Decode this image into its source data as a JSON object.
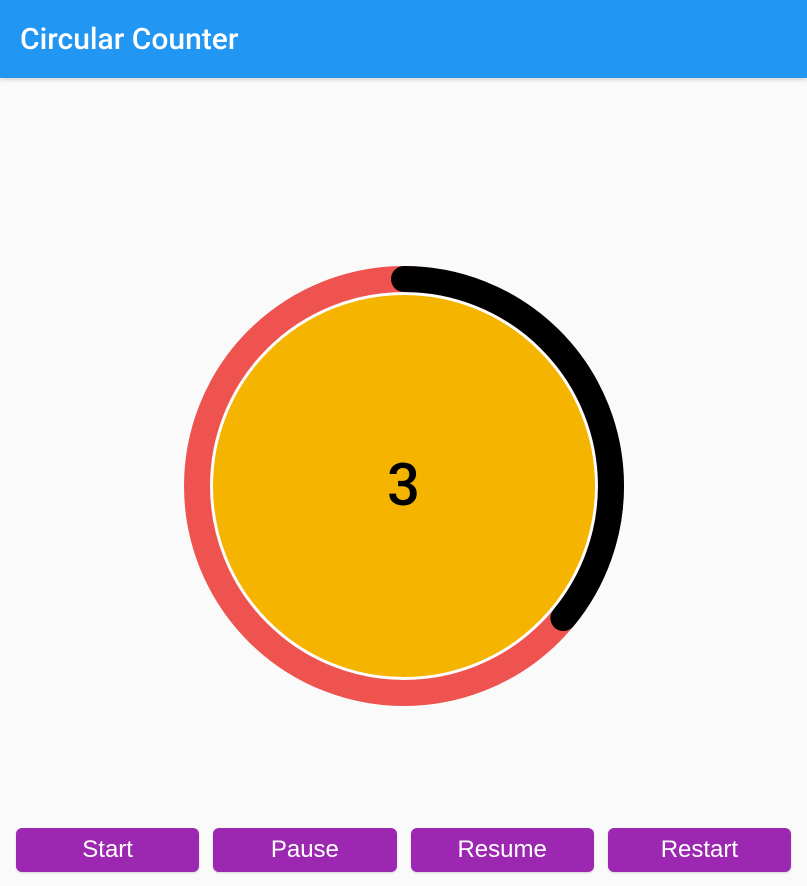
{
  "header": {
    "title": "Circular Counter"
  },
  "counter": {
    "value": "3",
    "progress_fraction": 0.36,
    "ring_stroke": 26,
    "inner_fill": "#F4B400",
    "bg_ring": "#EF5350",
    "progress_ring": "#000000"
  },
  "buttons": {
    "start": "Start",
    "pause": "Pause",
    "resume": "Resume",
    "restart": "Restart"
  },
  "colors": {
    "appbar": "#2196F3",
    "button": "#9C27B0"
  }
}
